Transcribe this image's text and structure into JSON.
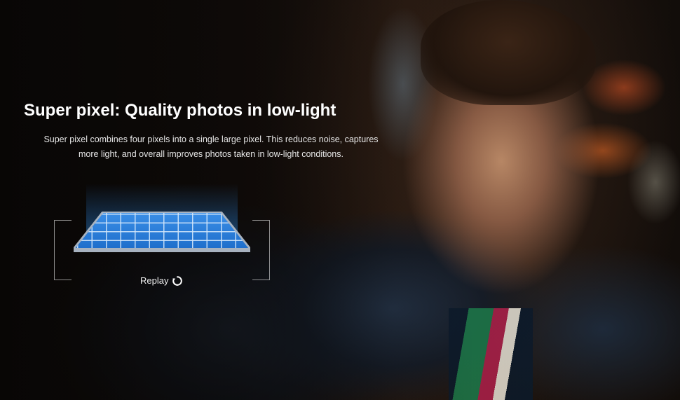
{
  "hero": {
    "title": "Super pixel: Quality photos in low-light",
    "description": "Super pixel combines four pixels into a single large pixel. This reduces noise, captures more light, and overall improves photos taken in low-light conditions."
  },
  "sensor_graphic": {
    "chip_color": "#1f6fcc",
    "grid_line_color": "#d2e6fa"
  },
  "replay": {
    "label": "Replay",
    "icon": "replay-icon"
  }
}
